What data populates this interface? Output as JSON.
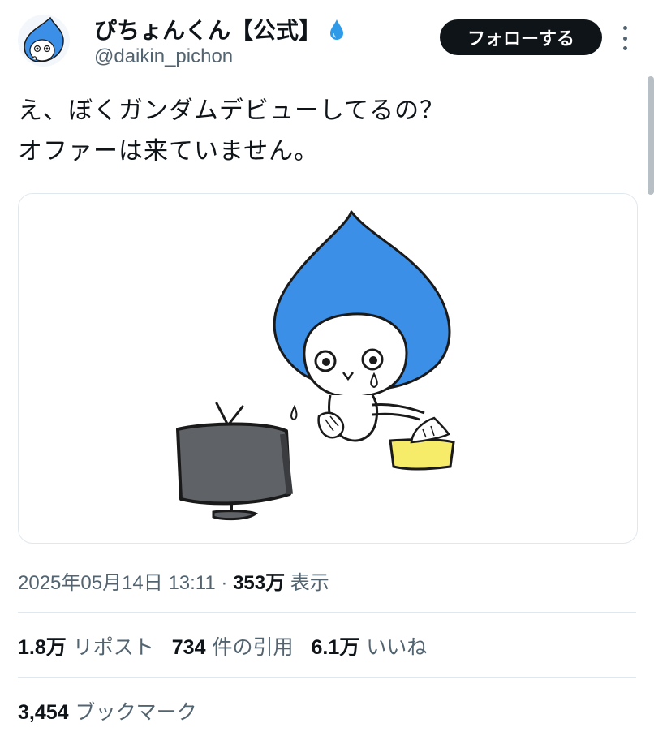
{
  "author": {
    "display_name": "ぴちょんくん【公式】",
    "handle": "@daikin_pichon",
    "avatar_icon": "pichon-avatar-icon",
    "badge_icon": "water-drop-icon",
    "badge_color": "#2f9be8"
  },
  "follow_button": {
    "label": "フォローする"
  },
  "tweet": {
    "lines": [
      "え、ぼくガンダムデビューしてるの？",
      "オファーは来ていません。"
    ]
  },
  "meta": {
    "datetime": "2025年05月14日 13:11",
    "separator": "·",
    "views_count": "353万",
    "views_label": "表示"
  },
  "stats": {
    "reposts_count": "1.8万",
    "reposts_label": "リポスト",
    "quotes_count": "734",
    "quotes_label": "件の引用",
    "likes_count": "6.1万",
    "likes_label": "いいね"
  },
  "bookmarks": {
    "count": "3,454",
    "label": "ブックマーク"
  },
  "colors": {
    "text": "#0f1419",
    "secondary": "#536471",
    "button_bg": "#0f1419",
    "illustration_blue": "#3b8fe6",
    "tissue_yellow": "#f7ec6a"
  }
}
